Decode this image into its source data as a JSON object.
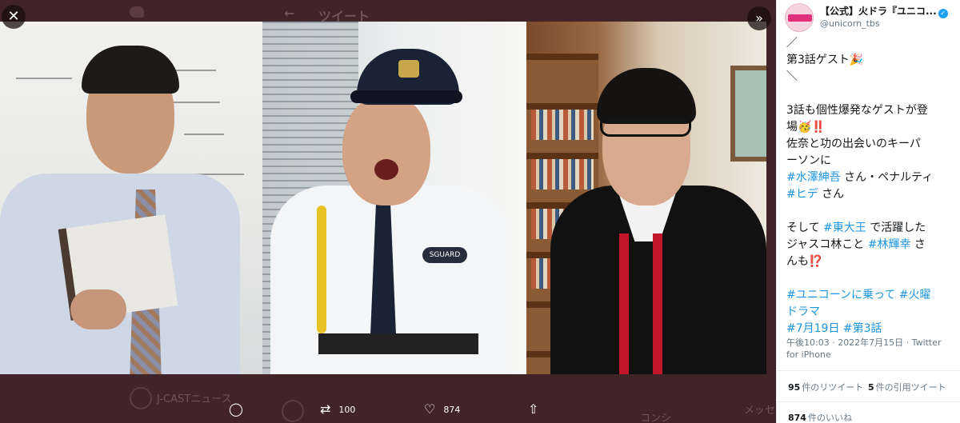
{
  "viewer": {
    "background_header_title": "ツイート",
    "background_rows": [
      {
        "text": "J-CASTニュース"
      },
      {
        "text": ""
      }
    ],
    "background_right_label": "コンシ",
    "background_right_label2": "メッセ",
    "close_icon": "close-icon",
    "expand_icon": "expand-icon",
    "guard_patch_text": "SGUARD",
    "actions": {
      "reply_count": "",
      "retweet_count": "100",
      "like_count": "874",
      "share_count": ""
    }
  },
  "tweet": {
    "author_name": "【公式】火ドラ『ユニコ...",
    "handle": "@unicorn_tbs",
    "body_lines": {
      "l1": "／",
      "l2": "第3話ゲスト🎉",
      "l3": "＼",
      "l4": "3話も個性爆発なゲストが登",
      "l5": "場🥳‼️",
      "l6": "佐奈と功の出会いのキーパ",
      "l7": "ーソンに",
      "l8_hash": "#水澤紳吾",
      "l8_text": " さん・ペナルティ",
      "l9_hash": "#ヒデ",
      "l9_text": " さん",
      "l10_a": "そして ",
      "l10_hash": "#東大王",
      "l10_b": " で活躍した",
      "l11_a": "ジャスコ林こと ",
      "l11_hash": "#林輝幸",
      "l11_b": " さ",
      "l12": "んも⁉️",
      "l13_hash1": "#ユニコーンに乗って",
      "l13_hash2": " #火曜",
      "l14_hash": "ドラマ",
      "l15_hash1": "#7月19日",
      "l15_hash2": " #第3話"
    },
    "timestamp": "午後10:03 · 2022年7月15日 · Twitter for iPhone",
    "retweets_count": "95",
    "retweets_label": "件のリツイート",
    "quotes_count": "5",
    "quotes_label": "件の引用ツイート",
    "likes_count": "874",
    "likes_label": "件のいいね"
  },
  "colors": {
    "viewer_bg": "#412428",
    "hashtag": "#1b95e0",
    "verified": "#1da1f2"
  }
}
